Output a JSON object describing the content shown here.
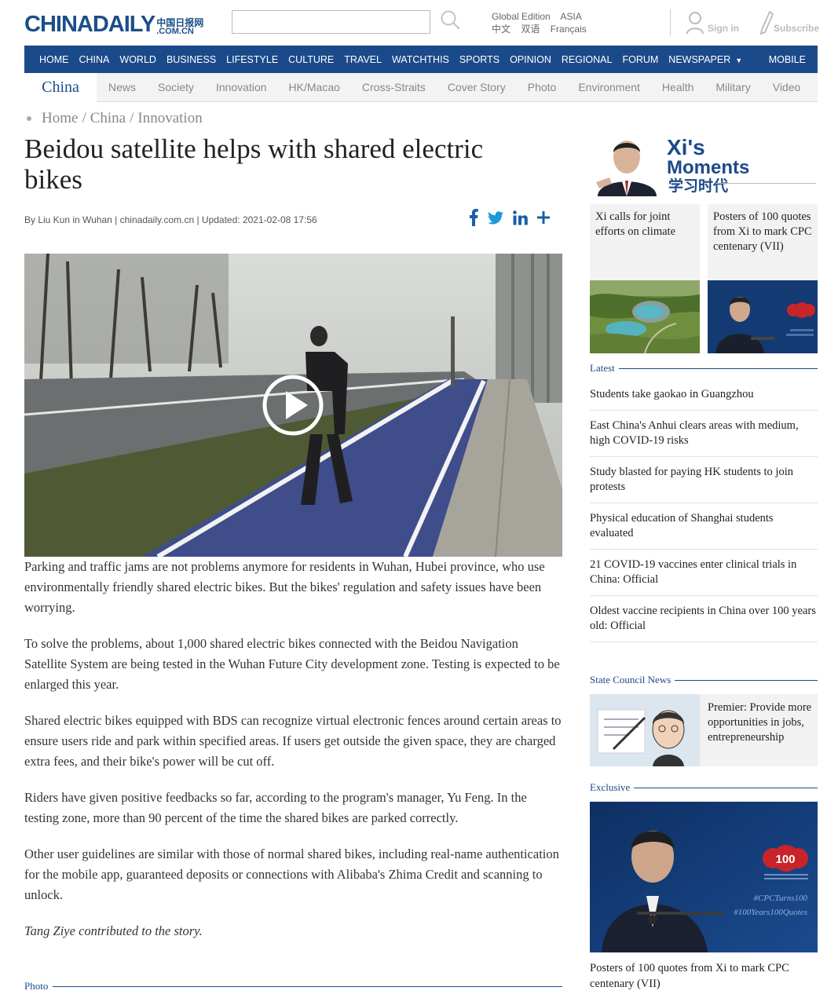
{
  "header": {
    "logo_main": "CHINA",
    "logo_daily": "DAILY",
    "logo_cn": "中国日报网",
    "logo_com": ".COM.CN",
    "search_placeholder": "",
    "editions": {
      "global": "Global Edition",
      "asia": "ASIA",
      "chinese": "中文",
      "bilingual": "双语",
      "french": "Français"
    },
    "sign_in": "Sign in",
    "subscribe": "Subscribe"
  },
  "nav": {
    "items": [
      "HOME",
      "CHINA",
      "WORLD",
      "BUSINESS",
      "LIFESTYLE",
      "CULTURE",
      "TRAVEL",
      "WATCHTHIS",
      "SPORTS",
      "OPINION",
      "REGIONAL",
      "FORUM",
      "NEWSPAPER"
    ],
    "mobile": "MOBILE"
  },
  "subnav": {
    "section": "China",
    "items": [
      "News",
      "Society",
      "Innovation",
      "HK/Macao",
      "Cross-Straits",
      "Cover Story",
      "Photo",
      "Environment",
      "Health",
      "Military",
      "Video"
    ]
  },
  "breadcrumb": {
    "home": "Home",
    "china": "China",
    "innovation": "Innovation",
    "separator": "/"
  },
  "article": {
    "title": "Beidou satellite helps with shared electric bikes",
    "byline": "By Liu Kun in Wuhan | chinadaily.com.cn | Updated: 2021-02-08 17:56",
    "paragraphs": [
      "Parking and traffic jams are not problems anymore for residents in Wuhan, Hubei province, who use environmentally friendly shared electric bikes. But the bikes' regulation and safety issues have been worrying.",
      "To solve the problems, about 1,000 shared electric bikes connected with the Beidou Navigation Satellite System are being tested in the Wuhan Future City development zone. Testing is expected to be enlarged this year.",
      "Shared electric bikes equipped with BDS can recognize virtual electronic fences around certain areas to ensure users ride and park within specified areas. If users get outside the given space, they are charged extra fees, and their bike's power will be cut off.",
      "Riders have given positive feedbacks so far, according to the program's manager, Yu Feng. In the testing zone, more than 90 percent of the time the shared bikes are parked correctly.",
      "Other user guidelines are similar with those of normal shared bikes, including real-name authentication for the mobile app, guaranteed deposits or connections with Alibaba's Zhima Credit and scanning to unlock."
    ],
    "credit": "Tang Ziye contributed to the story.",
    "photo_section": "Photo"
  },
  "sidebar": {
    "xi_banner": {
      "line1": "Xi's",
      "line2": "Moments",
      "line3": "学习时代"
    },
    "cards": [
      {
        "text": "Xi calls for joint efforts on climate"
      },
      {
        "text": "Posters of 100 quotes from Xi to mark CPC centenary (VII)"
      }
    ],
    "latest_label": "Latest",
    "latest": [
      "Students take gaokao in Guangzhou",
      "East China's Anhui clears areas with medium, high COVID-19 risks",
      "Study blasted for paying HK students to join protests",
      "Physical education of Shanghai students evaluated",
      "21 COVID-19 vaccines enter clinical trials in China: Official",
      "Oldest vaccine recipients in China over 100 years old: Official"
    ],
    "state_council_label": "State Council News",
    "state_council": {
      "text": "Premier: Provide more opportunities in jobs, entrepreneurship"
    },
    "exclusive_label": "Exclusive",
    "exclusive": {
      "caption": "Posters of 100 quotes from Xi to mark CPC centenary (VII)",
      "overlay_tag1": "#CPCTurns100",
      "overlay_tag2": "#100Years100Quotes",
      "logo_num": "100"
    }
  },
  "colors": {
    "brand_blue": "#1b4a8a",
    "share_blue": "#1b5ea8"
  }
}
